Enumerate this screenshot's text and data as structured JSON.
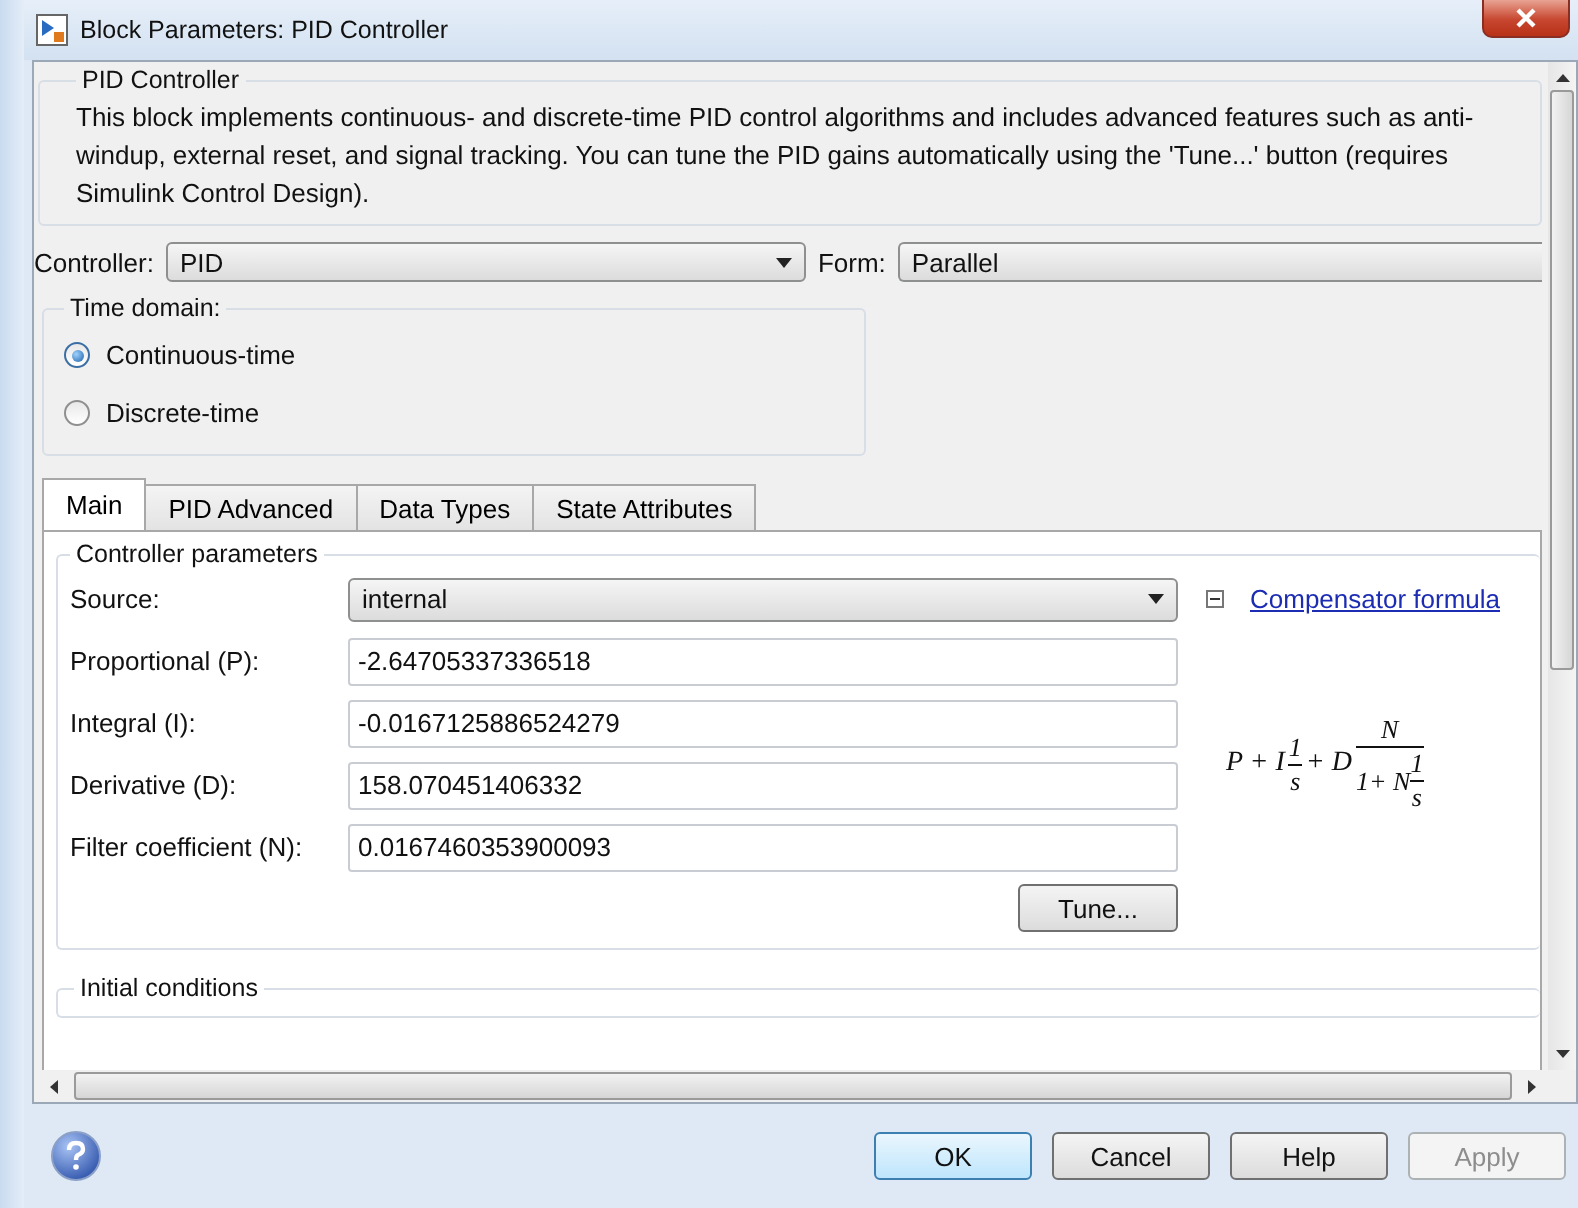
{
  "window": {
    "title": "Block Parameters: PID Controller"
  },
  "description": {
    "title": "PID Controller",
    "text": "This block implements continuous- and discrete-time PID control algorithms and includes advanced features such as anti-windup, external reset, and signal tracking. You can tune the PID gains automatically using the 'Tune...' button (requires Simulink Control Design)."
  },
  "controller": {
    "label": "Controller:",
    "value": "PID"
  },
  "form": {
    "label": "Form:",
    "value": "Parallel"
  },
  "time_domain": {
    "title": "Time domain:",
    "options": [
      {
        "label": "Continuous-time",
        "selected": true
      },
      {
        "label": "Discrete-time",
        "selected": false
      }
    ]
  },
  "tabs": [
    {
      "label": "Main",
      "selected": true
    },
    {
      "label": "PID Advanced",
      "selected": false
    },
    {
      "label": "Data Types",
      "selected": false
    },
    {
      "label": "State Attributes",
      "selected": false
    }
  ],
  "controller_parameters": {
    "title": "Controller parameters",
    "fields": [
      {
        "kind": "dropdown",
        "label": "Source:",
        "value": "internal"
      },
      {
        "kind": "text",
        "label": "Proportional (P):",
        "value": "-2.64705337336518"
      },
      {
        "kind": "text",
        "label": "Integral (I):",
        "value": "-0.0167125886524279"
      },
      {
        "kind": "text",
        "label": "Derivative (D):",
        "value": "158.070451406332"
      },
      {
        "kind": "text",
        "label": "Filter coefficient (N):",
        "value": "0.0167460353900093"
      }
    ],
    "tune_button": "Tune...",
    "formula_toggle": {
      "label": "Compensator formula",
      "expanded": true
    },
    "formula": [
      {
        "kind": "text",
        "text": "P + I"
      },
      {
        "kind": "frac",
        "num": "1",
        "den": [
          {
            "kind": "text",
            "text": "s"
          }
        ]
      },
      {
        "kind": "text",
        "text": "+ D"
      },
      {
        "kind": "frac",
        "num": "N",
        "den": [
          {
            "kind": "text",
            "text": "1+ N"
          },
          {
            "kind": "frac",
            "num": "1",
            "den": [
              {
                "kind": "text",
                "text": "s"
              }
            ]
          }
        ]
      }
    ]
  },
  "next_section": {
    "title": "Initial conditions"
  },
  "buttons": [
    {
      "label": "OK",
      "kind": "default",
      "disabled": false
    },
    {
      "label": "Cancel",
      "kind": "normal",
      "disabled": false
    },
    {
      "label": "Help",
      "kind": "normal",
      "disabled": false
    },
    {
      "label": "Apply",
      "kind": "normal",
      "disabled": true
    }
  ]
}
